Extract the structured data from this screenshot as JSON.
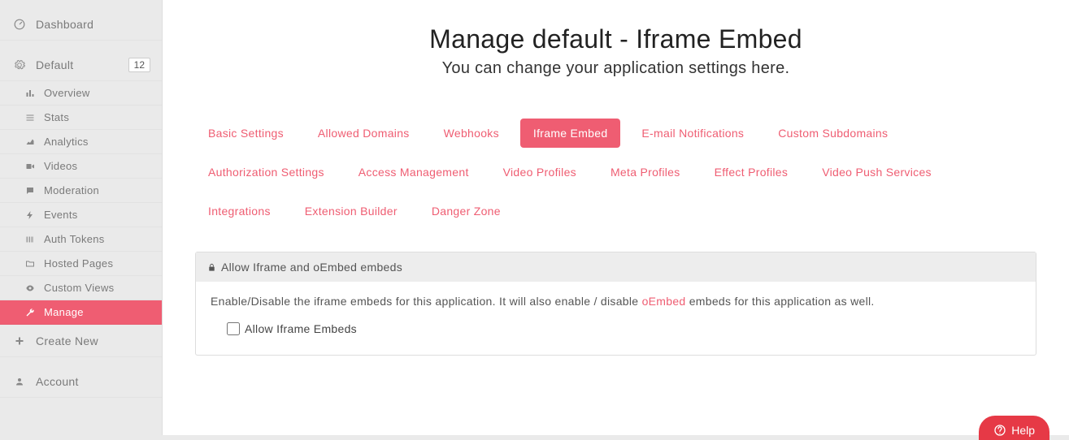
{
  "sidebar": {
    "dashboard": "Dashboard",
    "default": {
      "label": "Default",
      "badge": "12"
    },
    "items": [
      {
        "label": "Overview"
      },
      {
        "label": "Stats"
      },
      {
        "label": "Analytics"
      },
      {
        "label": "Videos"
      },
      {
        "label": "Moderation"
      },
      {
        "label": "Events"
      },
      {
        "label": "Auth Tokens"
      },
      {
        "label": "Hosted Pages"
      },
      {
        "label": "Custom Views"
      },
      {
        "label": "Manage"
      }
    ],
    "create_new": "Create New",
    "account": "Account"
  },
  "page": {
    "title": "Manage default - Iframe Embed",
    "subtitle": "You can change your application settings here."
  },
  "tabs": [
    "Basic Settings",
    "Allowed Domains",
    "Webhooks",
    "Iframe Embed",
    "E-mail Notifications",
    "Custom Subdomains",
    "Authorization Settings",
    "Access Management",
    "Video Profiles",
    "Meta Profiles",
    "Effect Profiles",
    "Video Push Services",
    "Integrations",
    "Extension Builder",
    "Danger Zone"
  ],
  "active_tab_index": 3,
  "panel": {
    "header": "Allow Iframe and oEmbed embeds",
    "desc_before": "Enable/Disable the iframe embeds for this application. It will also enable / disable ",
    "desc_link": "oEmbed",
    "desc_after": " embeds for this application as well.",
    "checkbox_label": "Allow Iframe Embeds",
    "checkbox_checked": false
  },
  "help_label": "Help"
}
